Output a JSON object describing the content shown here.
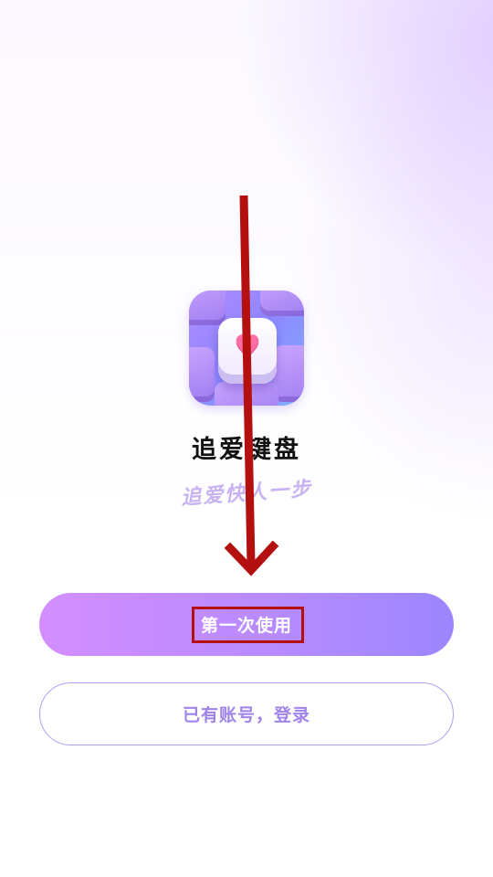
{
  "app": {
    "name": "追爱键盘",
    "slogan": "追爱快人一步",
    "icon": "heart-keyboard-icon"
  },
  "actions": {
    "first_use_label": "第一次使用",
    "login_label": "已有账号，登录"
  },
  "colors": {
    "primary_gradient_start": "#d38eff",
    "primary_gradient_end": "#9c86ff",
    "secondary_text": "#9f83ea",
    "annotation": "#b41010"
  },
  "annotation": {
    "type": "swipe-down-arrow",
    "target": "first-use-button"
  }
}
